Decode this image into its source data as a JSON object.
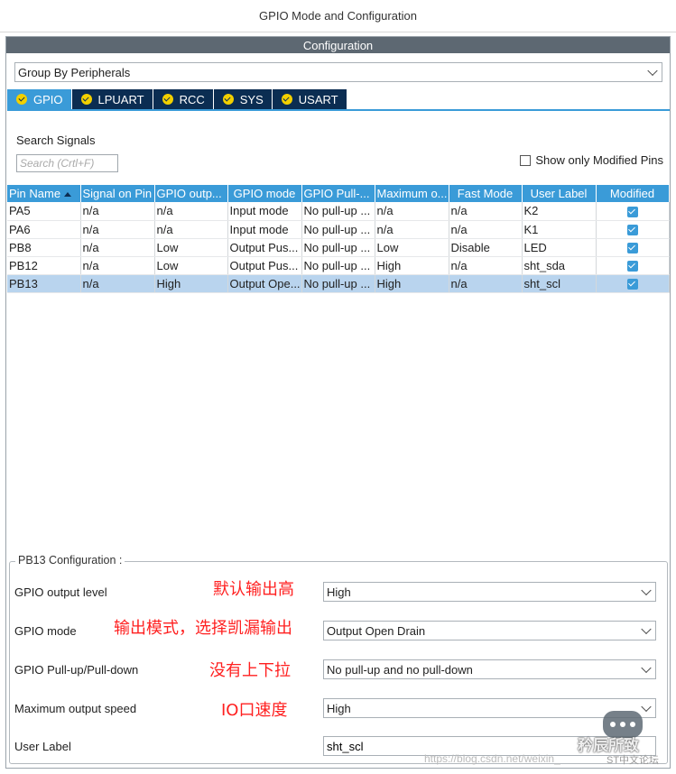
{
  "window": {
    "title": "GPIO Mode and Configuration"
  },
  "panel": {
    "header": "Configuration"
  },
  "group_select": {
    "value": "Group By Peripherals"
  },
  "tabs": [
    {
      "label": "GPIO",
      "active": true
    },
    {
      "label": "LPUART",
      "active": false
    },
    {
      "label": "RCC",
      "active": false
    },
    {
      "label": "SYS",
      "active": false
    },
    {
      "label": "USART",
      "active": false
    }
  ],
  "search": {
    "label": "Search Signals",
    "placeholder": "Search (Crtl+F)"
  },
  "show_modified": {
    "label": "Show only Modified Pins",
    "checked": false
  },
  "table": {
    "headers": [
      "Pin Name",
      "Signal on Pin",
      "GPIO outp...",
      "GPIO mode",
      "GPIO Pull-...",
      "Maximum o...",
      "Fast Mode",
      "User Label",
      "Modified"
    ],
    "rows": [
      {
        "pin": "PA5",
        "signal": "n/a",
        "output": "n/a",
        "mode": "Input mode",
        "pull": "No pull-up ...",
        "speed": "n/a",
        "fast": "n/a",
        "label": "K2",
        "modified": true
      },
      {
        "pin": "PA6",
        "signal": "n/a",
        "output": "n/a",
        "mode": "Input mode",
        "pull": "No pull-up ...",
        "speed": "n/a",
        "fast": "n/a",
        "label": "K1",
        "modified": true
      },
      {
        "pin": "PB8",
        "signal": "n/a",
        "output": "Low",
        "mode": "Output Pus...",
        "pull": "No pull-up ...",
        "speed": "Low",
        "fast": "Disable",
        "label": "LED",
        "modified": true
      },
      {
        "pin": "PB12",
        "signal": "n/a",
        "output": "Low",
        "mode": "Output Pus...",
        "pull": "No pull-up ...",
        "speed": "High",
        "fast": "n/a",
        "label": "sht_sda",
        "modified": true
      },
      {
        "pin": "PB13",
        "signal": "n/a",
        "output": "High",
        "mode": "Output Ope...",
        "pull": "No pull-up ...",
        "speed": "High",
        "fast": "n/a",
        "label": "sht_scl",
        "modified": true,
        "selected": true
      }
    ]
  },
  "config": {
    "title": "PB13 Configuration :",
    "output_level": {
      "label": "GPIO output level",
      "value": "High"
    },
    "mode": {
      "label": "GPIO mode",
      "value": "Output Open Drain"
    },
    "pull": {
      "label": "GPIO Pull-up/Pull-down",
      "value": "No pull-up and no pull-down"
    },
    "speed": {
      "label": "Maximum output speed",
      "value": "High"
    },
    "user_label": {
      "label": "User Label",
      "value": "sht_scl"
    }
  },
  "annotations": {
    "output_level": "默认输出高",
    "mode": "输出模式，选择凯漏输出",
    "pull": "没有上下拉",
    "speed": "IO口速度"
  },
  "watermark": {
    "url": "https://blog.csdn.net/weixin_",
    "brand": "矜辰所致",
    "sub": "ST中文论坛"
  },
  "colors": {
    "accent": "#3a9bd8",
    "tab_dark": "#0b2d52",
    "header_gray": "#5d6872",
    "annotation": "#ff2020"
  }
}
